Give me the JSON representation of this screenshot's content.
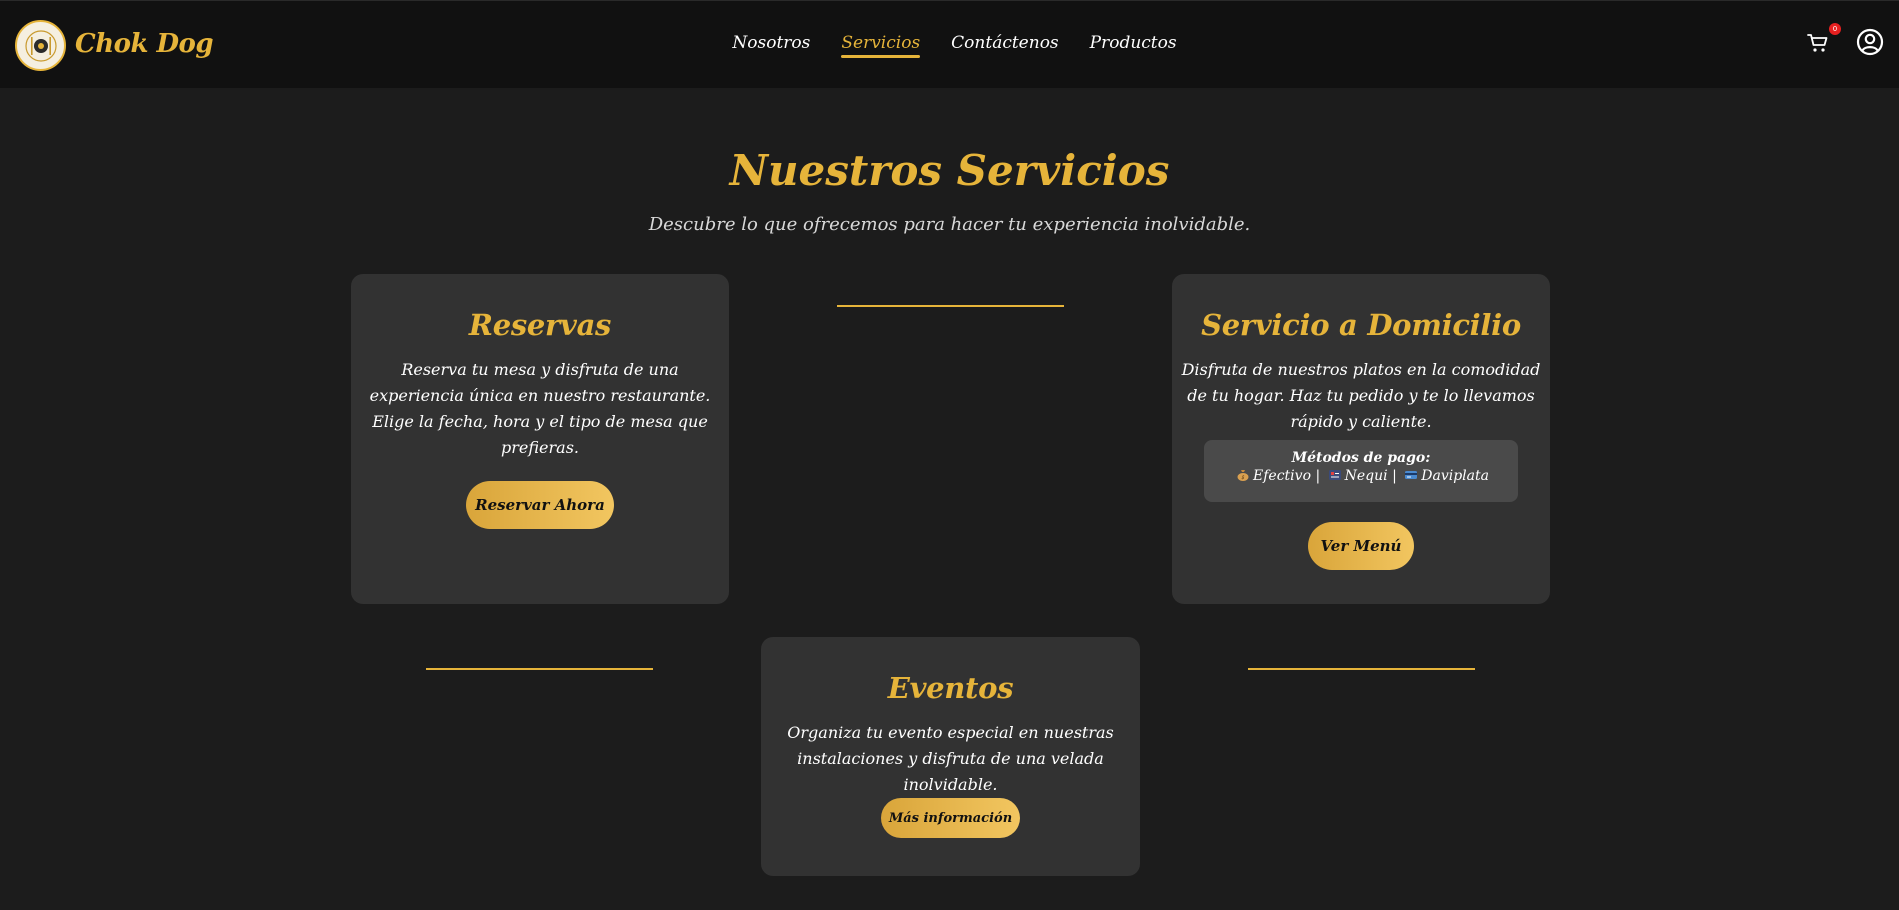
{
  "brand": {
    "name": "Chok Dog"
  },
  "nav": {
    "links": [
      {
        "label": "Nosotros",
        "active": false
      },
      {
        "label": "Servicios",
        "active": true
      },
      {
        "label": "Contáctenos",
        "active": false
      },
      {
        "label": "Productos",
        "active": false
      }
    ]
  },
  "header_icons": {
    "cart_icon": "cart-icon",
    "cart_count": "0",
    "user_icon": "user-circle-icon"
  },
  "hero": {
    "title": "Nuestros Servicios",
    "subtitle": "Descubre lo que ofrecemos para hacer tu experiencia inolvidable."
  },
  "cards": {
    "reservas": {
      "title": "Reservas",
      "text_lines": [
        "Reserva tu mesa y disfruta de una",
        "experiencia única en nuestro restaurante.",
        "Elige la fecha, hora y el tipo de mesa que",
        "prefieras."
      ],
      "button": "Reservar Ahora"
    },
    "domicilio": {
      "title": "Servicio a Domicilio",
      "text_lines": [
        "Disfruta de nuestros platos en la comodidad",
        "de tu hogar. Haz tu pedido y te lo llevamos",
        "rápido y caliente."
      ],
      "payment_title": "Métodos de pago:",
      "payment_methods": [
        {
          "icon": "money-bag-icon",
          "label": "Efectivo"
        },
        {
          "icon": "phone-card-icon",
          "label": "Nequi"
        },
        {
          "icon": "card-icon",
          "label": "Daviplata"
        }
      ],
      "payment_separator": "|",
      "button": "Ver Menú"
    },
    "eventos": {
      "title": "Eventos",
      "text_lines": [
        "Organiza tu evento especial en nuestras",
        "instalaciones y disfruta de una velada",
        "inolvidable."
      ],
      "button": "Más información"
    }
  },
  "colors": {
    "accent": "#e6b43a",
    "background": "#1c1c1c",
    "navbar": "#111111",
    "card": "#323232",
    "badge": "#e62020"
  }
}
